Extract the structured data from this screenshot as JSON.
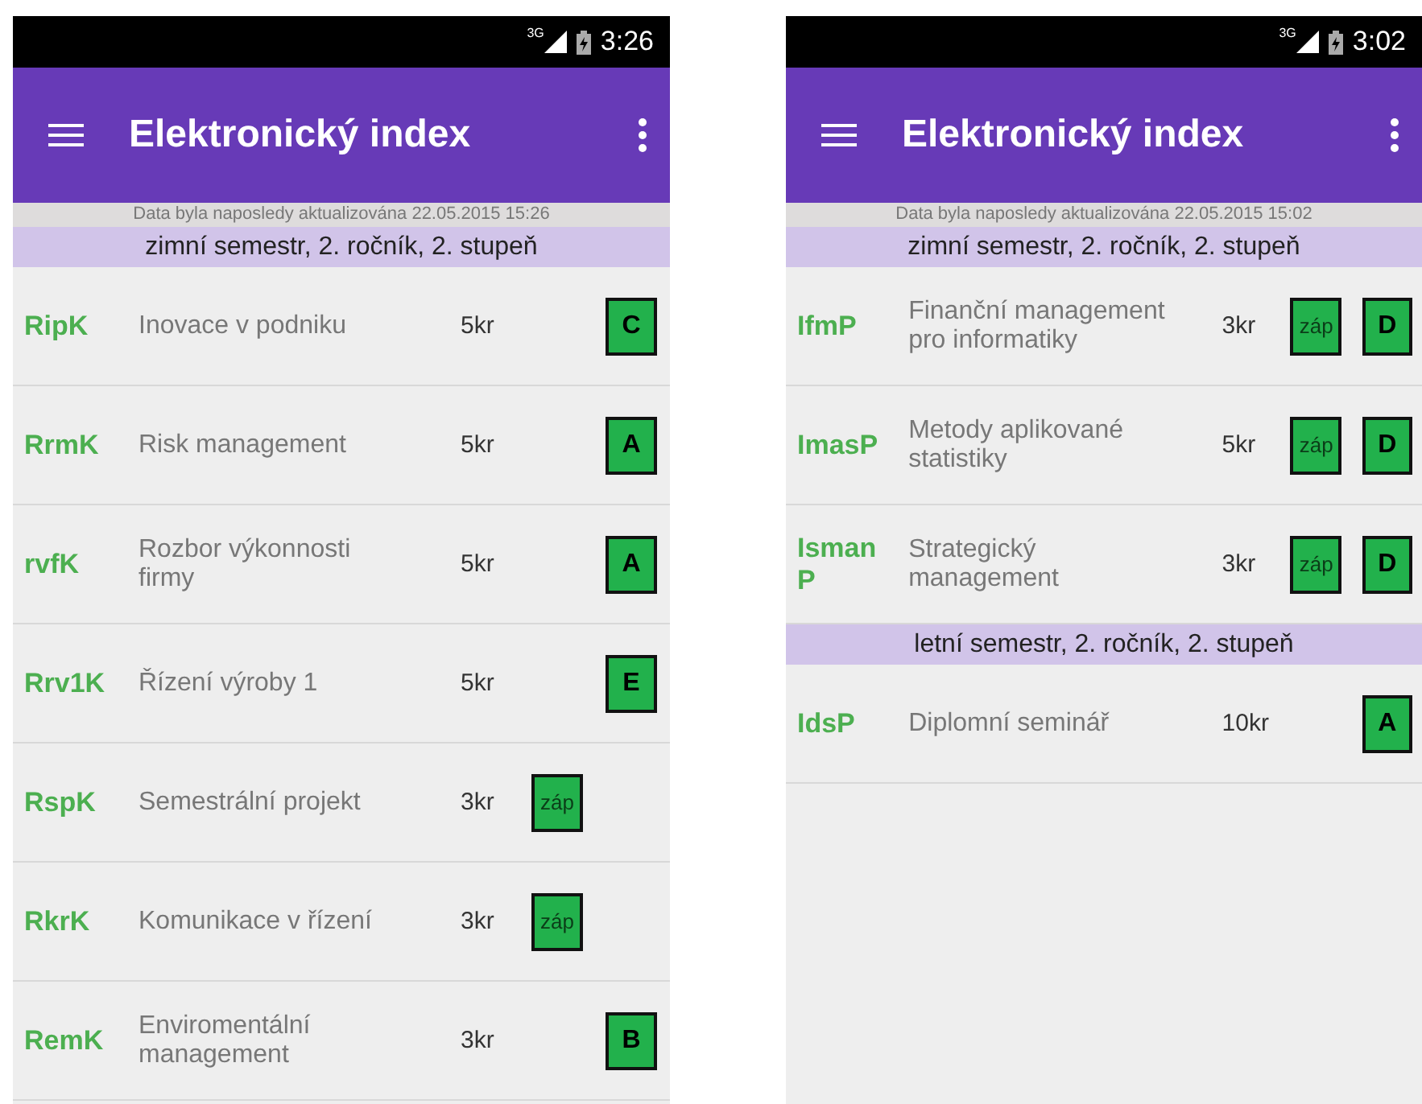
{
  "screens": [
    {
      "status_bar": {
        "network": "3G",
        "time": "3:26"
      },
      "title": "Elektronický index",
      "updated": "Data byla naposledy aktualizována 22.05.2015 15:26",
      "sections": [
        {
          "header": "zimní semestr, 2. ročník, 2. stupeň",
          "courses": [
            {
              "code": "RipK",
              "name": "Inovace v podniku",
              "credits": "5kr",
              "grade": "C"
            },
            {
              "code": "RrmK",
              "name": "Risk management",
              "credits": "5kr",
              "grade": "A"
            },
            {
              "code": "rvfK",
              "name": "Rozbor výkonnosti firmy",
              "credits": "5kr",
              "grade": "A"
            },
            {
              "code": "Rrv1K",
              "name": "Řízení výroby 1",
              "credits": "5kr",
              "grade": "E"
            },
            {
              "code": "RspK",
              "name": "Semestrální projekt",
              "credits": "3kr",
              "credit_mark": "záp"
            },
            {
              "code": "RkrK",
              "name": "Komunikace v řízení",
              "credits": "3kr",
              "credit_mark": "záp"
            },
            {
              "code": "RemK",
              "name": "Enviromentální management",
              "credits": "3kr",
              "grade": "B"
            }
          ]
        }
      ]
    },
    {
      "status_bar": {
        "network": "3G",
        "time": "3:02"
      },
      "title": "Elektronický index",
      "updated": "Data byla naposledy aktualizována 22.05.2015 15:02",
      "sections": [
        {
          "header": "zimní semestr, 2. ročník, 2. stupeň",
          "courses": [
            {
              "code": "IfmP",
              "name": "Finanční management pro informatiky",
              "credits": "3kr",
              "credit_mark": "záp",
              "grade": "D"
            },
            {
              "code": "ImasP",
              "name": "Metody aplikované statistiky",
              "credits": "5kr",
              "credit_mark": "záp",
              "grade": "D"
            },
            {
              "code": "Isman P",
              "name": "Strategický management",
              "credits": "3kr",
              "credit_mark": "záp",
              "grade": "D"
            }
          ]
        },
        {
          "header": "letní semestr, 2. ročník, 2. stupeň",
          "courses": [
            {
              "code": "IdsP",
              "name": "Diplomní seminář",
              "credits": "10kr",
              "grade": "A"
            }
          ]
        }
      ]
    }
  ]
}
